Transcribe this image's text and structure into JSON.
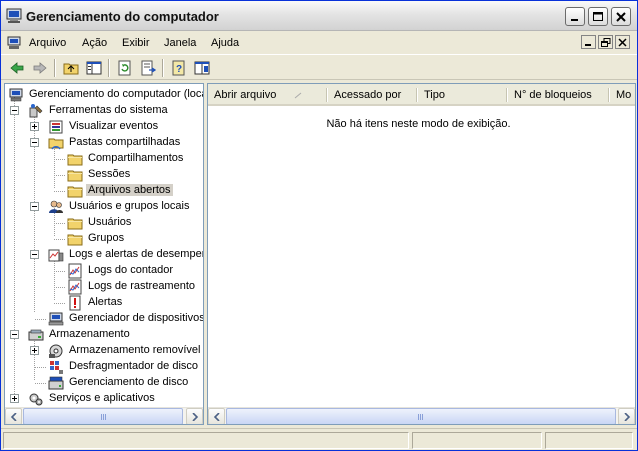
{
  "window": {
    "title": "Gerenciamento do computador"
  },
  "menu": {
    "items": [
      "Arquivo",
      "Ação",
      "Exibir",
      "Janela",
      "Ajuda"
    ]
  },
  "toolbar": {
    "buttons": [
      "back-arrow-icon",
      "forward-arrow-icon",
      "up-folder-icon",
      "show-hide-tree-icon",
      "refresh-icon",
      "export-list-icon",
      "help-icon",
      "properties-icon"
    ]
  },
  "tree": {
    "root": "Gerenciamento do computador (local)",
    "items": [
      {
        "label": "Ferramentas do sistema",
        "icon": "tools-icon"
      },
      {
        "label": "Visualizar eventos",
        "icon": "event-viewer-icon"
      },
      {
        "label": "Pastas compartilhadas",
        "icon": "shared-folder-icon"
      },
      {
        "label": "Compartilhamentos",
        "icon": "folder-icon"
      },
      {
        "label": "Sessões",
        "icon": "folder-icon"
      },
      {
        "label": "Arquivos abertos",
        "icon": "folder-icon",
        "selected": true
      },
      {
        "label": "Usuários e grupos locais",
        "icon": "users-icon"
      },
      {
        "label": "Usuários",
        "icon": "folder-icon"
      },
      {
        "label": "Grupos",
        "icon": "folder-icon"
      },
      {
        "label": "Logs e alertas de desempenho",
        "icon": "performance-logs-icon"
      },
      {
        "label": "Logs do contador",
        "icon": "chart-icon"
      },
      {
        "label": "Logs de rastreamento",
        "icon": "chart-icon"
      },
      {
        "label": "Alertas",
        "icon": "alert-icon"
      },
      {
        "label": "Gerenciador de dispositivos",
        "icon": "device-manager-icon"
      },
      {
        "label": "Armazenamento",
        "icon": "storage-icon"
      },
      {
        "label": "Armazenamento removível",
        "icon": "removable-storage-icon"
      },
      {
        "label": "Desfragmentador de disco",
        "icon": "defrag-icon"
      },
      {
        "label": "Gerenciamento de disco",
        "icon": "disk-management-icon"
      },
      {
        "label": "Serviços e aplicativos",
        "icon": "services-icon"
      }
    ]
  },
  "list": {
    "columns": [
      "Abrir arquivo",
      "Acessado por",
      "Tipo",
      "N° de bloqueios",
      "Mo"
    ],
    "empty_message": "Não há itens neste modo de exibição."
  }
}
